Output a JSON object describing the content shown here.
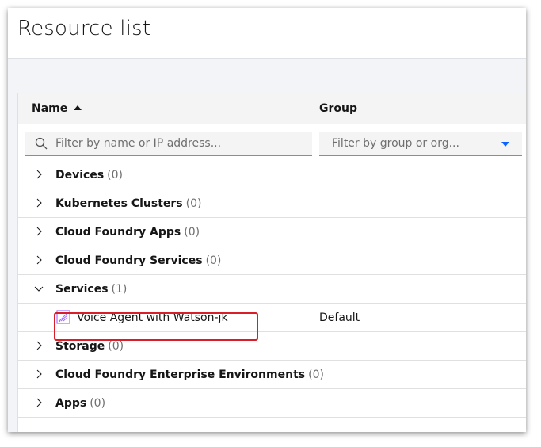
{
  "page": {
    "title": "Resource list"
  },
  "table": {
    "columns": {
      "name": "Name",
      "group": "Group"
    },
    "search": {
      "placeholder": "Filter by name or IP address...",
      "value": ""
    },
    "group_filter": {
      "placeholder": "Filter by group or org..."
    },
    "categories": [
      {
        "name": "Devices",
        "count": "(0)",
        "expanded": false
      },
      {
        "name": "Kubernetes Clusters",
        "count": "(0)",
        "expanded": false
      },
      {
        "name": "Cloud Foundry Apps",
        "count": "(0)",
        "expanded": false
      },
      {
        "name": "Cloud Foundry Services",
        "count": "(0)",
        "expanded": false
      },
      {
        "name": "Services",
        "count": "(1)",
        "expanded": true
      },
      {
        "name": "Storage",
        "count": "(0)",
        "expanded": false
      },
      {
        "name": "Cloud Foundry Enterprise Environments",
        "count": "(0)",
        "expanded": false
      },
      {
        "name": "Apps",
        "count": "(0)",
        "expanded": false
      }
    ],
    "service_item": {
      "name": "Voice Agent with Watson-jk",
      "group": "Default",
      "icon": "voice-agent-icon"
    }
  },
  "colors": {
    "accent": "#0f62fe",
    "highlight": "#da1e28",
    "service_icon": "#a56eff"
  }
}
